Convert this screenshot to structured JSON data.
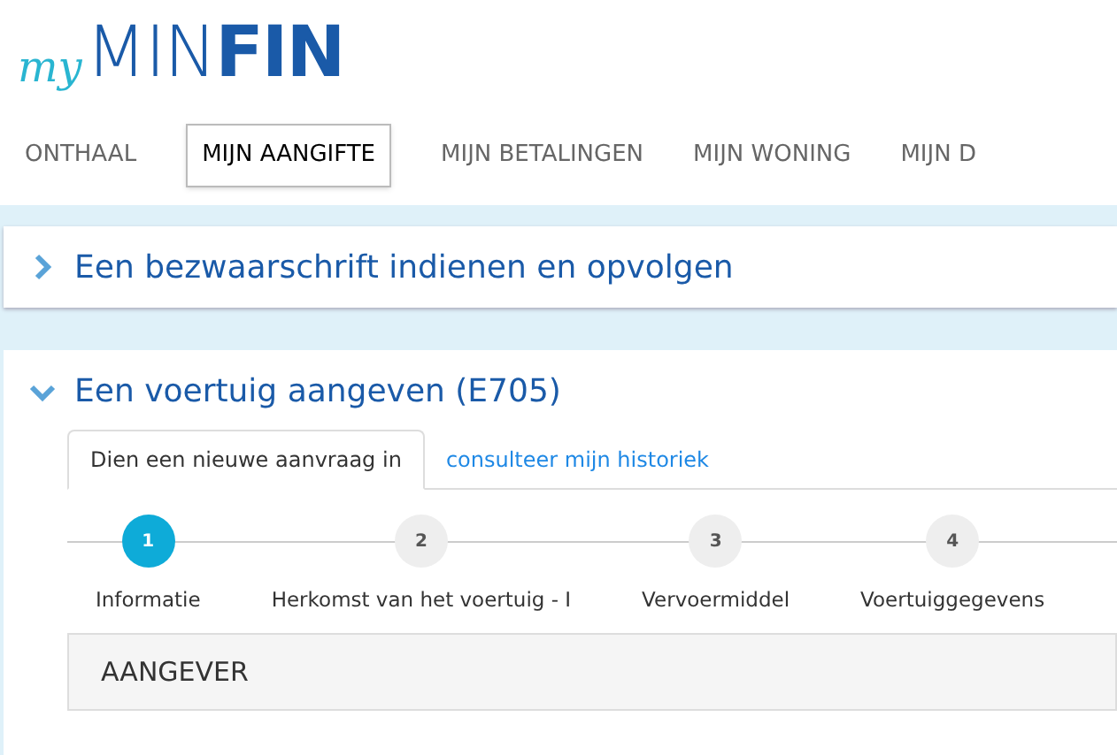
{
  "logo": {
    "prefix": "my",
    "light": "MIN",
    "bold": "FIN"
  },
  "nav": [
    {
      "label": "ONTHAAL",
      "selected": false
    },
    {
      "label": "MIJN AANGIFTE",
      "selected": true
    },
    {
      "label": "MIJN BETALINGEN",
      "selected": false
    },
    {
      "label": "MIJN WONING",
      "selected": false
    },
    {
      "label": "MIJN D",
      "selected": false
    }
  ],
  "sections": [
    {
      "title": "Een bezwaarschrift indienen en opvolgen",
      "expanded": false
    },
    {
      "title": "Een voertuig aangeven (E705)",
      "expanded": true,
      "tabs": [
        {
          "label": "Dien een nieuwe aanvraag in",
          "selected": true
        },
        {
          "label": "consulteer mijn historiek",
          "selected": false
        }
      ],
      "steps": [
        {
          "number": "1",
          "label": "Informatie",
          "selected": true
        },
        {
          "number": "2",
          "label": "Herkomst van het voertuig - I",
          "selected": false
        },
        {
          "number": "3",
          "label": "Vervoermiddel",
          "selected": false
        },
        {
          "number": "4",
          "label": "Voertuiggegevens",
          "selected": false
        }
      ],
      "panel": {
        "title": "AANGEVER"
      }
    }
  ]
}
